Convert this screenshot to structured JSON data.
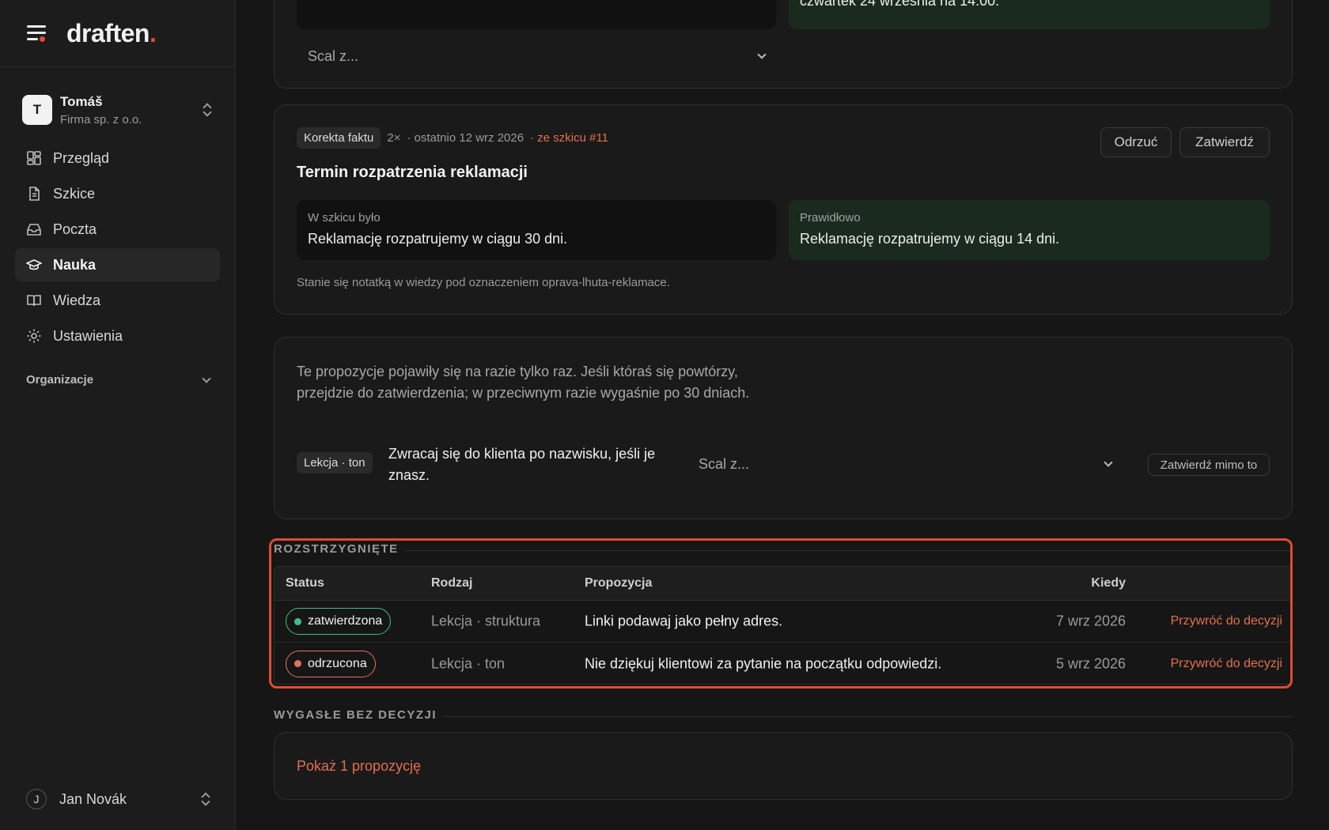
{
  "brand": {
    "name": "draften",
    "dot": "."
  },
  "workspace": {
    "initial": "T",
    "name": "Tomáš",
    "company": "Firma sp. z o.o."
  },
  "nav": [
    {
      "label": "Przegląd",
      "icon": "dashboard-icon"
    },
    {
      "label": "Szkice",
      "icon": "document-icon"
    },
    {
      "label": "Poczta",
      "icon": "inbox-icon"
    },
    {
      "label": "Nauka",
      "icon": "graduation-cap-icon",
      "active": true
    },
    {
      "label": "Wiedza",
      "icon": "book-icon"
    },
    {
      "label": "Ustawienia",
      "icon": "gear-icon"
    }
  ],
  "organizations_label": "Organizacje",
  "user": {
    "initial": "J",
    "name": "Jan Novák"
  },
  "top_card": {
    "green_text": "czwartek 24 września na 14:00.",
    "merge_placeholder": "Scal z..."
  },
  "fact_card": {
    "tag": "Korekta faktu",
    "count": "2×",
    "last_seen": "· ostatnio 12 wrz 2026",
    "source": "· ze szkicu #11",
    "reject_label": "Odrzuć",
    "approve_label": "Zatwierdź",
    "title": "Termin rozpatrzenia reklamacji",
    "before_label": "W szkicu było",
    "before_text": "Reklamację rozpatrujemy w ciągu 30 dni.",
    "after_label": "Prawidłowo",
    "after_text": "Reklamację rozpatrujemy w ciągu 14 dni.",
    "note": "Stanie się notatką w wiedzy pod oznaczeniem oprava-lhuta-reklamace."
  },
  "once_card": {
    "text": "Te propozycje pojawiły się na razie tylko raz. Jeśli któraś się powtórzy, przejdzie do zatwierdzenia; w przeciwnym razie wygaśnie po 30 dniach.",
    "tag": "Lekcja · ton",
    "proposal": "Zwracaj się do klienta po nazwisku, jeśli je znasz.",
    "merge_placeholder": "Scal z...",
    "approve_anyway_label": "Zatwierdź mimo to"
  },
  "resolved": {
    "section_label": "ROZSTRZYGNIĘTE",
    "columns": {
      "status": "Status",
      "kind": "Rodzaj",
      "proposal": "Propozycja",
      "when": "Kiedy"
    },
    "rows": [
      {
        "status": "zatwierdzona",
        "kind": "Lekcja · struktura",
        "proposal": "Linki podawaj jako pełny adres.",
        "when": "7 wrz 2026",
        "action": "Przywróć do decyzji"
      },
      {
        "status": "odrzucona",
        "kind": "Lekcja · ton",
        "proposal": "Nie dziękuj klientowi za pytanie na początku odpowiedzi.",
        "when": "5 wrz 2026",
        "action": "Przywróć do decyzji"
      }
    ]
  },
  "expired": {
    "section_label": "WYGASŁE BEZ DECYZJI",
    "show_label": "Pokaż 1 propozycję"
  },
  "colors": {
    "accent": "#e36f4d",
    "brand_dot": "#e04a36",
    "approved": "#3fbf86",
    "rejected": "#e36f62",
    "highlight": "#e04a36"
  }
}
